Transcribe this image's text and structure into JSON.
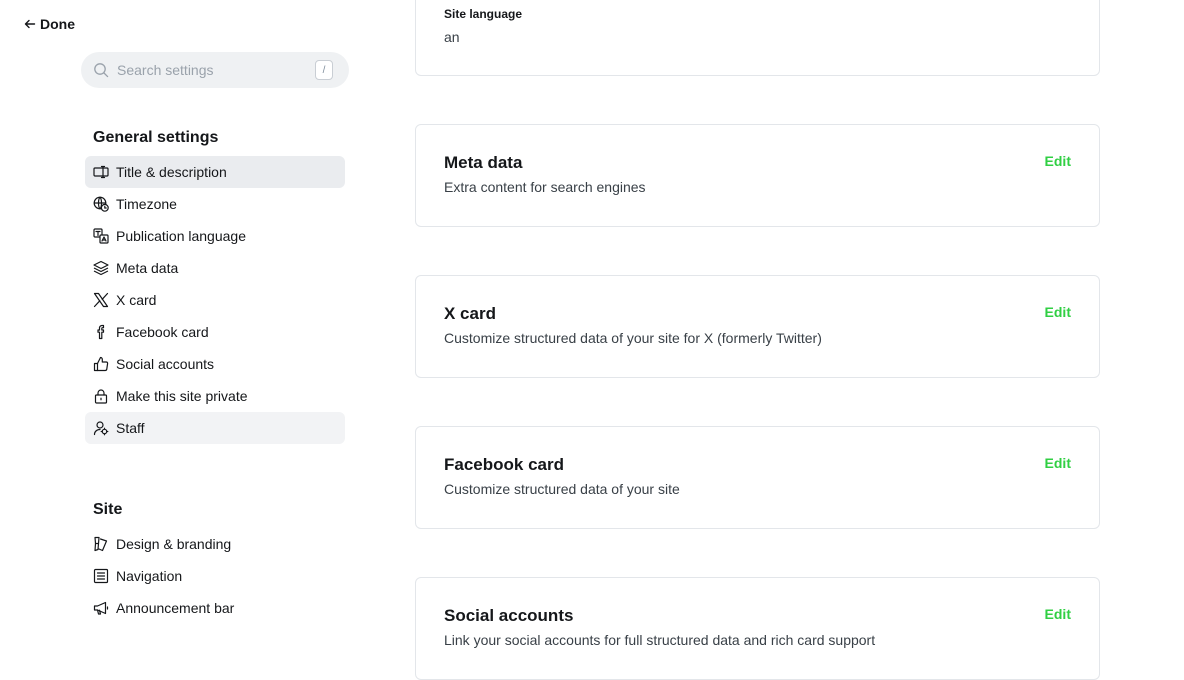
{
  "sidebar": {
    "done_label": "Done",
    "search": {
      "placeholder": "Search settings",
      "shortcut": "/"
    },
    "general": {
      "title": "General settings",
      "items": [
        {
          "label": "Title & description",
          "icon": "title-icon",
          "state": "active"
        },
        {
          "label": "Timezone",
          "icon": "globe-clock-icon",
          "state": ""
        },
        {
          "label": "Publication language",
          "icon": "translate-icon",
          "state": ""
        },
        {
          "label": "Meta data",
          "icon": "layers-icon",
          "state": ""
        },
        {
          "label": "X card",
          "icon": "x-logo-icon",
          "state": ""
        },
        {
          "label": "Facebook card",
          "icon": "facebook-icon",
          "state": ""
        },
        {
          "label": "Social accounts",
          "icon": "thumbs-up-icon",
          "state": ""
        },
        {
          "label": "Make this site private",
          "icon": "lock-icon",
          "state": ""
        },
        {
          "label": "Staff",
          "icon": "staff-icon",
          "state": "hover"
        }
      ]
    },
    "site": {
      "title": "Site",
      "items": [
        {
          "label": "Design & branding",
          "icon": "paintbrush-icon"
        },
        {
          "label": "Navigation",
          "icon": "list-icon"
        },
        {
          "label": "Announcement bar",
          "icon": "megaphone-icon"
        }
      ]
    }
  },
  "main": {
    "language_card": {
      "label": "Site language",
      "value": "an"
    },
    "cards": [
      {
        "title": "Meta data",
        "description": "Extra content for search engines",
        "action": "Edit"
      },
      {
        "title": "X card",
        "description": "Customize structured data of your site for X (formerly Twitter)",
        "action": "Edit"
      },
      {
        "title": "Facebook card",
        "description": "Customize structured data of your site",
        "action": "Edit"
      },
      {
        "title": "Social accounts",
        "description": "Link your social accounts for full structured data and rich card support",
        "action": "Edit"
      }
    ]
  },
  "colors": {
    "accent_green": "#30cf43",
    "active_bg": "#eaecef",
    "border": "#e3e6ea"
  }
}
